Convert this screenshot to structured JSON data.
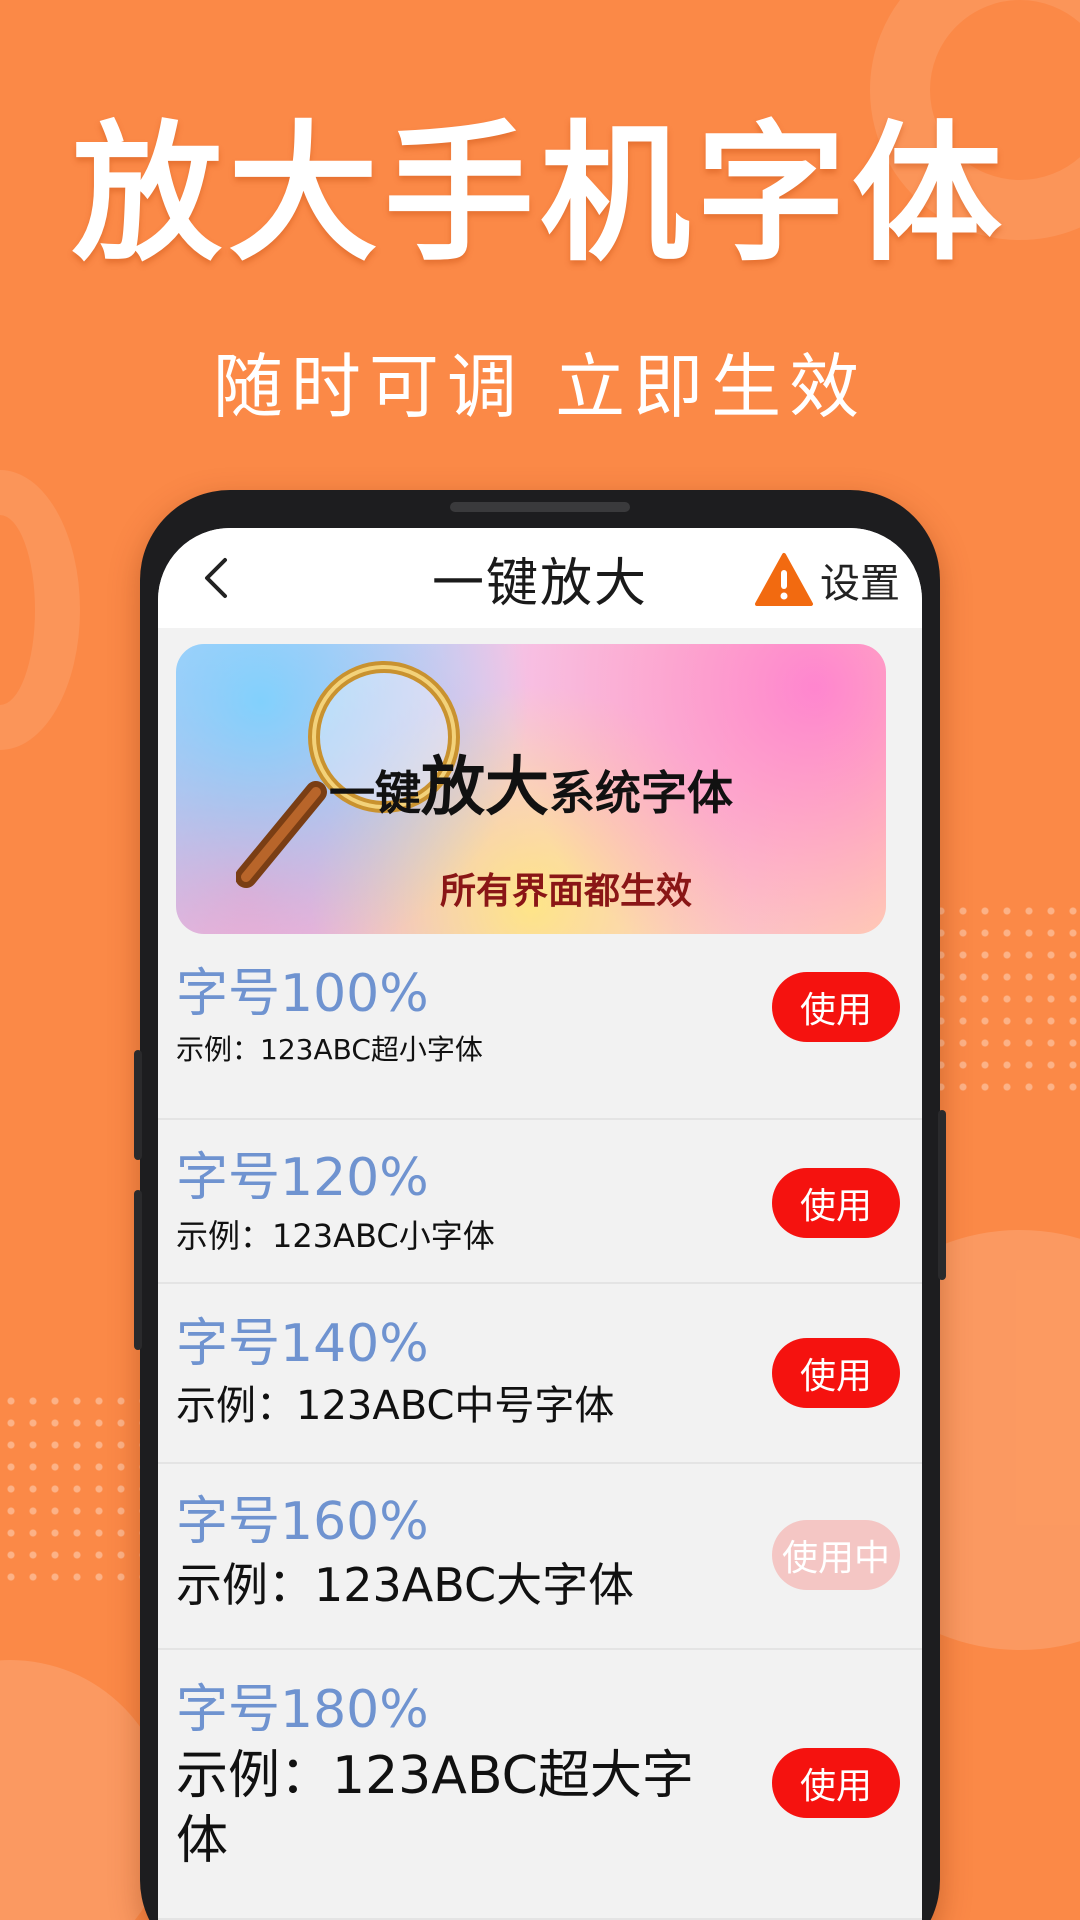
{
  "hero": {
    "title": "放大手机字体",
    "subtitle": "随时可调 立即生效"
  },
  "navbar": {
    "back_icon": "chevron-left-icon",
    "title": "一键放大",
    "warning_icon": "warning-triangle-icon",
    "settings_label": "设置"
  },
  "banner": {
    "prefix": "一键",
    "highlight": "放大",
    "suffix": "系统字体",
    "subtitle": "所有界面都生效"
  },
  "font_options": [
    {
      "size_label": "字号100%",
      "example": "示例：123ABC超小字体",
      "button": "使用",
      "active": false
    },
    {
      "size_label": "字号120%",
      "example": "示例：123ABC小字体",
      "button": "使用",
      "active": false
    },
    {
      "size_label": "字号140%",
      "example": "示例：123ABC中号字体",
      "button": "使用",
      "active": false
    },
    {
      "size_label": "字号160%",
      "example": "示例：123ABC大字体",
      "button": "使用中",
      "active": true
    },
    {
      "size_label": "字号180%",
      "example": "示例：123ABC超大字体",
      "button": "使用",
      "active": false
    }
  ],
  "colors": {
    "background": "#fb8947",
    "accent_red": "#f5120f",
    "active_button": "#f4c6c4",
    "size_label_blue": "#6f93d0"
  }
}
